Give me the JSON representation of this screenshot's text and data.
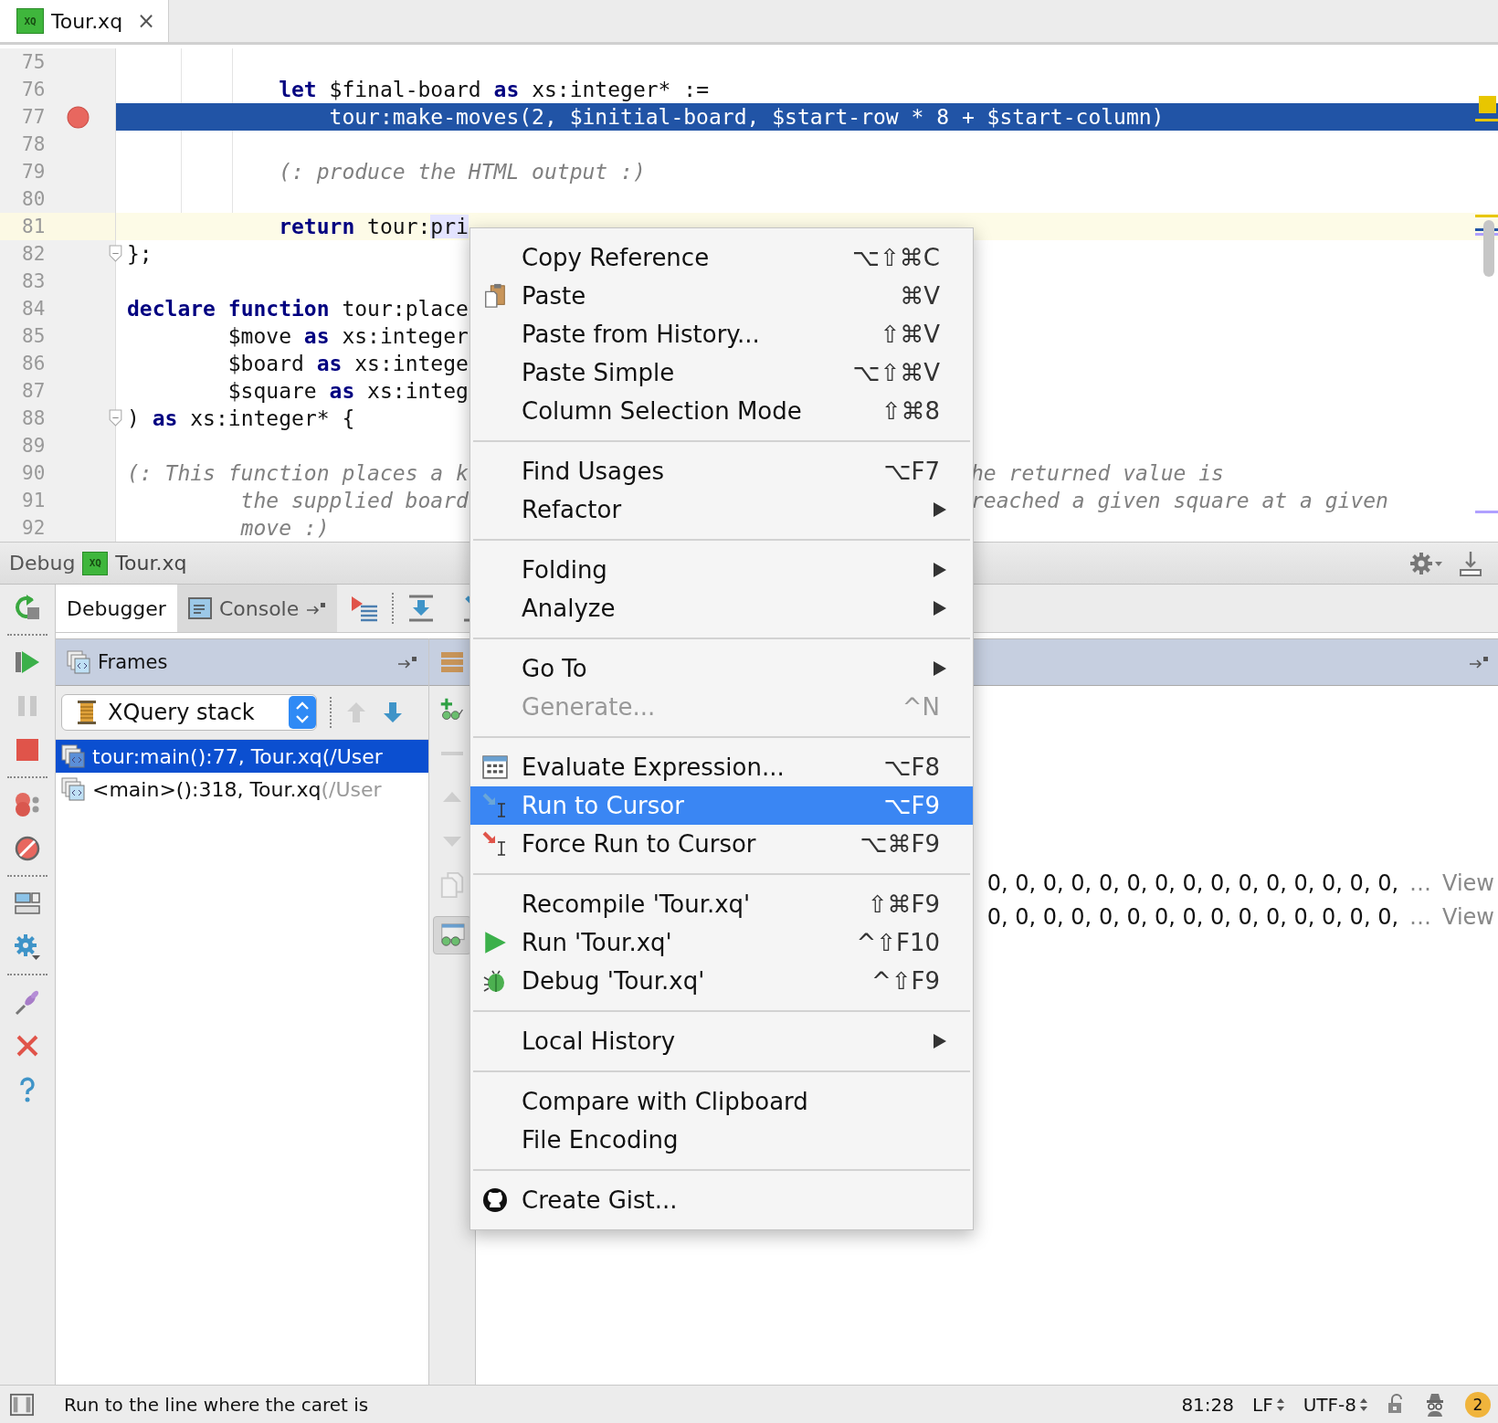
{
  "editor_tabs": [
    {
      "label": "Tour.xq",
      "icon_label": "XQ",
      "close": "×",
      "selected": true
    }
  ],
  "code_lines": [
    {
      "number": "75",
      "breakpoint": false,
      "execution": false,
      "caret": false,
      "fold": false
    },
    {
      "number": "76",
      "breakpoint": false,
      "execution": false,
      "caret": false,
      "fold": false,
      "segments": [
        {
          "kind": "keyword",
          "text": "            let"
        },
        {
          "kind": "plain",
          "text": " $final-board "
        },
        {
          "kind": "keyword",
          "text": "as"
        },
        {
          "kind": "plain",
          "text": " xs:integer* :="
        }
      ]
    },
    {
      "number": "77",
      "breakpoint": true,
      "execution": true,
      "caret": false,
      "fold": false,
      "segments": [
        {
          "kind": "plain",
          "text": "                tour:make-moves(2, $initial-board, $start-row * 8 + $start-column)"
        }
      ]
    },
    {
      "number": "78",
      "breakpoint": false,
      "execution": false,
      "caret": false,
      "fold": false
    },
    {
      "number": "79",
      "breakpoint": false,
      "execution": false,
      "caret": false,
      "fold": false,
      "segments": [
        {
          "kind": "comment",
          "text": "            (: produce the HTML output :)"
        }
      ]
    },
    {
      "number": "80",
      "breakpoint": false,
      "execution": false,
      "caret": false,
      "fold": false
    },
    {
      "number": "81",
      "breakpoint": false,
      "execution": false,
      "caret": true,
      "fold": false,
      "segments": [
        {
          "kind": "keyword",
          "text": "            return"
        },
        {
          "kind": "plain",
          "text": " tour:"
        },
        {
          "kind": "usage",
          "text": "pri"
        }
      ]
    },
    {
      "number": "82",
      "breakpoint": false,
      "execution": false,
      "caret": false,
      "fold": true,
      "segments": [
        {
          "kind": "plain",
          "text": "};"
        }
      ]
    },
    {
      "number": "83",
      "breakpoint": false,
      "execution": false,
      "caret": false,
      "fold": false
    },
    {
      "number": "84",
      "breakpoint": false,
      "execution": false,
      "caret": false,
      "fold": false,
      "segments": [
        {
          "kind": "keyword",
          "text": "declare"
        },
        {
          "kind": "keyword",
          "text": " function"
        },
        {
          "kind": "plain",
          "text": " tour:place"
        }
      ]
    },
    {
      "number": "85",
      "breakpoint": false,
      "execution": false,
      "caret": false,
      "fold": false,
      "segments": [
        {
          "kind": "plain",
          "text": "        $move "
        },
        {
          "kind": "keyword",
          "text": "as"
        },
        {
          "kind": "plain",
          "text": " xs:integer"
        }
      ]
    },
    {
      "number": "86",
      "breakpoint": false,
      "execution": false,
      "caret": false,
      "fold": false,
      "segments": [
        {
          "kind": "plain",
          "text": "        $board "
        },
        {
          "kind": "keyword",
          "text": "as"
        },
        {
          "kind": "plain",
          "text": " xs:intege"
        }
      ]
    },
    {
      "number": "87",
      "breakpoint": false,
      "execution": false,
      "caret": false,
      "fold": false,
      "segments": [
        {
          "kind": "plain",
          "text": "        $square "
        },
        {
          "kind": "keyword",
          "text": "as"
        },
        {
          "kind": "plain",
          "text": " xs:integ"
        }
      ]
    },
    {
      "number": "88",
      "breakpoint": false,
      "execution": false,
      "caret": false,
      "fold": true,
      "segments": [
        {
          "kind": "plain",
          "text": ") "
        },
        {
          "kind": "keyword",
          "text": "as"
        },
        {
          "kind": "plain",
          "text": " xs:integer* {"
        }
      ]
    },
    {
      "number": "89",
      "breakpoint": false,
      "execution": false,
      "caret": false,
      "fold": false
    },
    {
      "number": "90",
      "breakpoint": false,
      "execution": false,
      "caret": false,
      "fold": false,
      "segments": [
        {
          "kind": "comment",
          "text": "(: This function places a k"
        }
      ],
      "right_text": "he returned value is"
    },
    {
      "number": "91",
      "breakpoint": false,
      "execution": false,
      "caret": false,
      "fold": false,
      "segments": [
        {
          "kind": "comment",
          "text": "         the supplied board"
        }
      ],
      "right_text": "reached a given square at a given"
    },
    {
      "number": "92",
      "breakpoint": false,
      "execution": false,
      "caret": false,
      "fold": false,
      "segments": [
        {
          "kind": "comment",
          "text": "         move :)"
        }
      ]
    }
  ],
  "debug_panel": {
    "title": "Debug",
    "icon_label": "XQ",
    "config": "Tour.xq",
    "tabs": [
      {
        "label": "Debugger",
        "selected": true
      },
      {
        "label": "Console",
        "selected": false
      }
    ]
  },
  "frames": {
    "title": "Frames",
    "thread": "XQuery stack",
    "items": [
      {
        "label": "tour:main():77, Tour.xq",
        "path": "(/User",
        "selected": true
      },
      {
        "label": "<main>():318, Tour.xq",
        "path": "(/User",
        "selected": false
      }
    ]
  },
  "variables": {
    "rows": [
      {
        "value": "0, 0, 0, 0, 0, 0, 0, 0, 0, 0, 0, 0, 0, 0, 0,",
        "more": "…",
        "link": "View"
      },
      {
        "value": "0, 0, 0, 0, 0, 0, 0, 0, 0, 0, 0, 0, 0, 0, 0,",
        "more": "…",
        "link": "View"
      }
    ]
  },
  "context_menu": {
    "sections": [
      {
        "items": [
          {
            "label": "Copy Reference",
            "shortcut": "⌥⇧⌘C",
            "kind": "plain",
            "submenu": false,
            "disabled": false,
            "selected": false
          },
          {
            "label": "Paste",
            "shortcut": "⌘V",
            "kind": "paste",
            "submenu": false,
            "disabled": false,
            "selected": false
          },
          {
            "label": "Paste from History...",
            "shortcut": "⇧⌘V",
            "kind": "plain",
            "submenu": false,
            "disabled": false,
            "selected": false
          },
          {
            "label": "Paste Simple",
            "shortcut": "⌥⇧⌘V",
            "kind": "plain",
            "submenu": false,
            "disabled": false,
            "selected": false
          },
          {
            "label": "Column Selection Mode",
            "shortcut": "⇧⌘8",
            "kind": "plain",
            "submenu": false,
            "disabled": false,
            "selected": false
          }
        ]
      },
      {
        "items": [
          {
            "label": "Find Usages",
            "shortcut": "⌥F7",
            "kind": "plain",
            "submenu": false,
            "disabled": false,
            "selected": false
          },
          {
            "label": "Refactor",
            "kind": "plain",
            "submenu": true,
            "disabled": false,
            "selected": false
          }
        ]
      },
      {
        "items": [
          {
            "label": "Folding",
            "kind": "plain",
            "submenu": true,
            "disabled": false,
            "selected": false
          },
          {
            "label": "Analyze",
            "kind": "plain",
            "submenu": true,
            "disabled": false,
            "selected": false
          }
        ]
      },
      {
        "items": [
          {
            "label": "Go To",
            "kind": "plain",
            "submenu": true,
            "disabled": false,
            "selected": false
          },
          {
            "label": "Generate...",
            "shortcut": "^N",
            "kind": "plain",
            "submenu": false,
            "disabled": true,
            "selected": false
          }
        ]
      },
      {
        "items": [
          {
            "label": "Evaluate Expression...",
            "shortcut": "⌥F8",
            "kind": "evaluate",
            "submenu": false,
            "disabled": false,
            "selected": false
          },
          {
            "label": "Run to Cursor",
            "shortcut": "⌥F9",
            "kind": "run-cursor",
            "submenu": false,
            "disabled": false,
            "selected": true
          },
          {
            "label": "Force Run to Cursor",
            "shortcut": "⌥⌘F9",
            "kind": "force-run",
            "submenu": false,
            "disabled": false,
            "selected": false
          }
        ]
      },
      {
        "items": [
          {
            "label": "Recompile 'Tour.xq'",
            "shortcut": "⇧⌘F9",
            "kind": "plain",
            "submenu": false,
            "disabled": false,
            "selected": false
          },
          {
            "label": "Run 'Tour.xq'",
            "shortcut": "^⇧F10",
            "kind": "run",
            "submenu": false,
            "disabled": false,
            "selected": false
          },
          {
            "label": "Debug 'Tour.xq'",
            "shortcut": "^⇧F9",
            "kind": "debug",
            "submenu": false,
            "disabled": false,
            "selected": false
          }
        ]
      },
      {
        "items": [
          {
            "label": "Local History",
            "kind": "plain",
            "submenu": true,
            "disabled": false,
            "selected": false
          }
        ]
      },
      {
        "items": [
          {
            "label": "Compare with Clipboard",
            "kind": "plain",
            "submenu": false,
            "disabled": false,
            "selected": false
          },
          {
            "label": "File Encoding",
            "kind": "plain",
            "submenu": false,
            "disabled": false,
            "selected": false
          }
        ]
      },
      {
        "items": [
          {
            "label": "Create Gist...",
            "kind": "github",
            "submenu": false,
            "disabled": false,
            "selected": false
          }
        ]
      }
    ]
  },
  "status_bar": {
    "message": "Run to the line where the caret is",
    "position": "81:28",
    "line_separator": "LF",
    "encoding": "UTF-8",
    "notifications": "2"
  }
}
